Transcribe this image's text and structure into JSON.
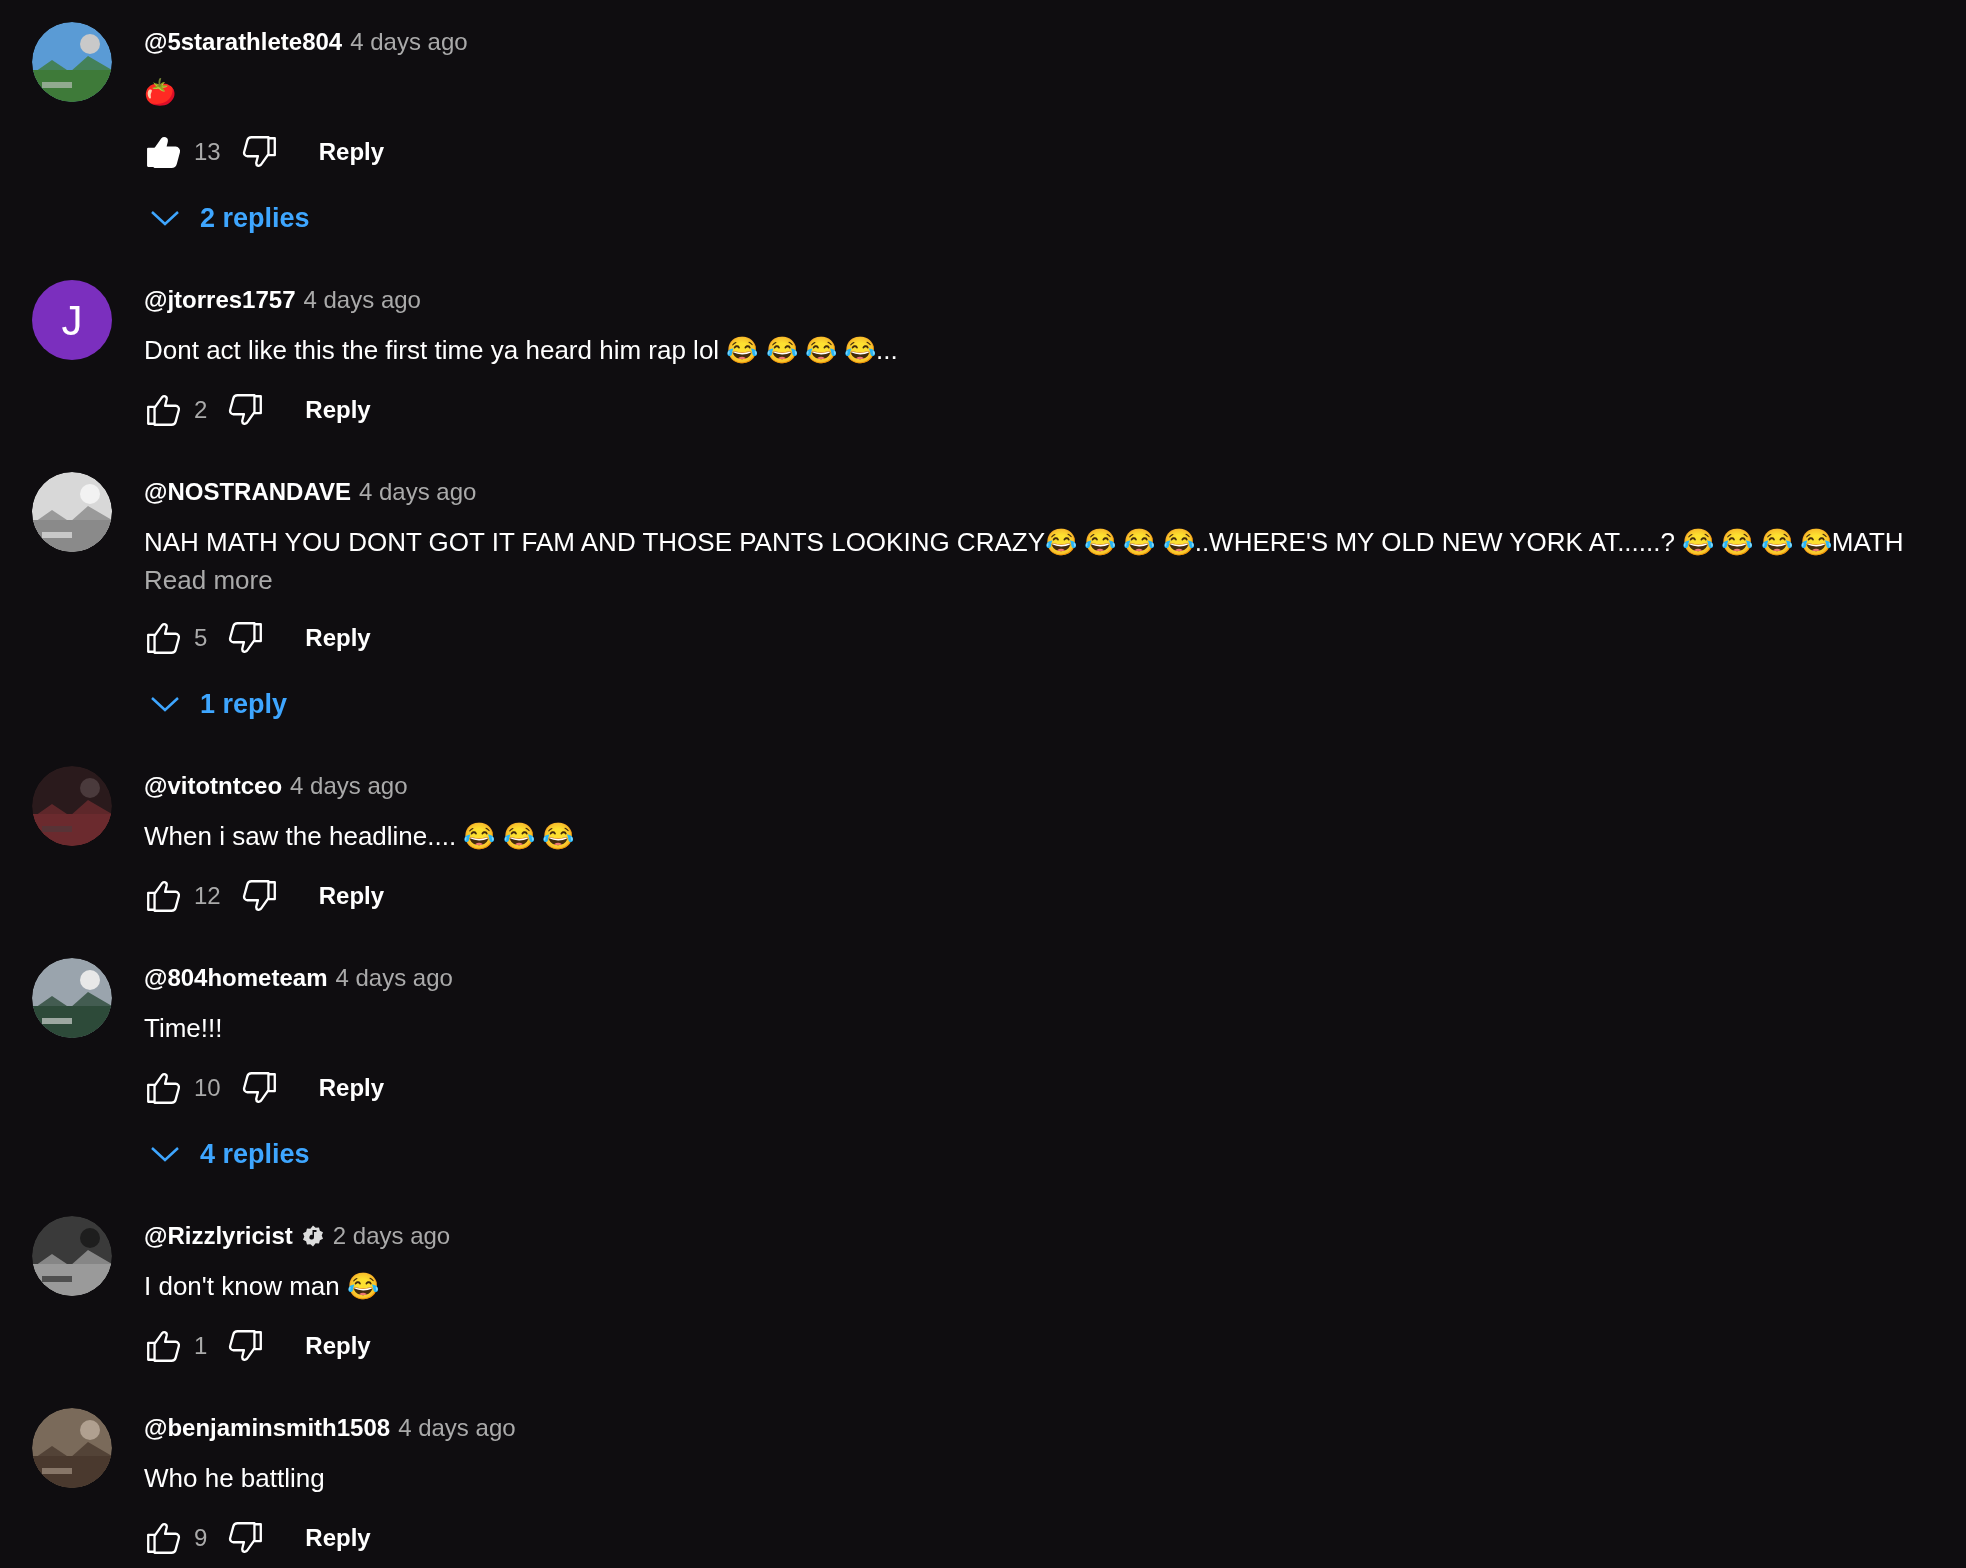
{
  "comments": [
    {
      "author": "@5starathlete804",
      "verified": false,
      "time": "4 days ago",
      "text": "🍅",
      "likes": "13",
      "liked": true,
      "reply_label": "Reply",
      "replies": "2 replies"
    },
    {
      "avatar": {
        "kind": "letter",
        "letter": "J",
        "color": "#7b2fbe"
      },
      "author": "@jtorres1757",
      "verified": false,
      "time": "4 days ago",
      "text": "Dont act like this the first time ya heard him rap lol  😂 😂 😂 😂...",
      "likes": "2",
      "liked": false,
      "reply_label": "Reply"
    },
    {
      "author": "@NOSTRANDAVE",
      "verified": false,
      "time": "4 days ago",
      "text": "NAH MATH YOU DONT GOT IT FAM AND THOSE PANTS LOOKING CRAZY😂 😂 😂 😂..WHERE'S MY OLD NEW YORK AT......? 😂 😂 😂 😂MATH",
      "read_more": "Read more",
      "likes": "5",
      "liked": false,
      "reply_label": "Reply",
      "replies": "1 reply"
    },
    {
      "author": "@vitotntceo",
      "verified": false,
      "time": "4 days ago",
      "text": "When i saw the headline.... 😂 😂 😂",
      "likes": "12",
      "liked": false,
      "reply_label": "Reply"
    },
    {
      "author": "@804hometeam",
      "verified": false,
      "time": "4 days ago",
      "text": "Time!!!",
      "likes": "10",
      "liked": false,
      "reply_label": "Reply",
      "replies": "4 replies"
    },
    {
      "author": "@Rizzlyricist",
      "verified": true,
      "time": "2 days ago",
      "text": "I don't know man  😂",
      "likes": "1",
      "liked": false,
      "reply_label": "Reply"
    },
    {
      "author": "@benjaminsmith1508",
      "verified": false,
      "time": "4 days ago",
      "text": "Who he battling",
      "likes": "9",
      "liked": false,
      "reply_label": "Reply"
    }
  ]
}
